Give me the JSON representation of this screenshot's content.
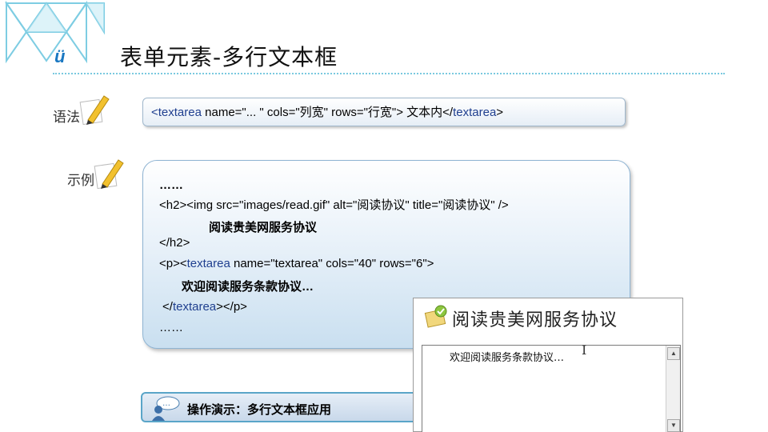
{
  "title": "表单元素-多行文本框",
  "labels": {
    "syntax": "语法",
    "example": "示例"
  },
  "syntax": {
    "open": "<textarea",
    "attrs": "  name=\"... \"  cols=\"列宽\"  rows=\"行宽\"> 文本内</",
    "close_kw": "textarea",
    "end": ">"
  },
  "example": {
    "lines": {
      "ellipsis_top": "……",
      "h2_open": "<h2><img  src=\"images/read.gif\" alt=\"阅读协议\" title=\"阅读协议\" />",
      "h2_text": "阅读贵美网服务协议",
      "h2_close": "</h2>",
      "p_prefix": "<p><",
      "p_kw": "textarea",
      "p_attrs": "  name=\"textarea\"  cols=\"40\"  rows=\"6\">",
      "textarea_content": "欢迎阅读服务条款协议…",
      "close_prefix": "</",
      "close_kw": "textarea",
      "close_suffix": "></p>",
      "ellipsis_bottom": "……"
    }
  },
  "demo_button": {
    "label": "操作演示：多行文本框应用"
  },
  "preview": {
    "heading": "阅读贵美网服务协议",
    "textarea_value": "欢迎阅读服务条款协议…",
    "cursor": "I"
  },
  "colors": {
    "accent": "#7ac9df",
    "keyword": "#1f3f8f",
    "box_border": "#8fb4d3"
  }
}
